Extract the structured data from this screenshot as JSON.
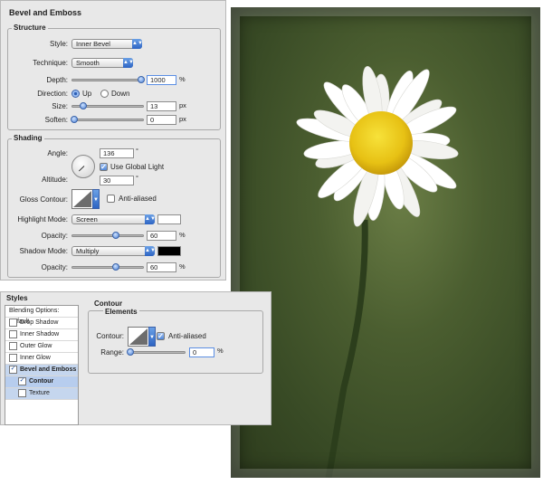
{
  "bevel_panel": {
    "title": "Bevel and Emboss",
    "structure": {
      "title": "Structure",
      "style": {
        "label": "Style:",
        "value": "Inner Bevel"
      },
      "technique": {
        "label": "Technique:",
        "value": "Smooth"
      },
      "depth": {
        "label": "Depth:",
        "value": "1000",
        "unit": "%",
        "slider_fraction": 1.0
      },
      "direction": {
        "label": "Direction:",
        "up": "Up",
        "down": "Down",
        "selected": "Up"
      },
      "size": {
        "label": "Size:",
        "value": "13",
        "unit": "px",
        "slider_fraction": 0.1
      },
      "soften": {
        "label": "Soften:",
        "value": "0",
        "unit": "px",
        "slider_fraction": 0.0
      }
    },
    "shading": {
      "title": "Shading",
      "angle": {
        "label": "Angle:",
        "value": "136",
        "unit": "°"
      },
      "global_light": {
        "label": "Use Global Light",
        "checked": true
      },
      "altitude": {
        "label": "Altitude:",
        "value": "30",
        "unit": "°"
      },
      "gloss_contour": {
        "label": "Gloss Contour:",
        "anti_aliased_label": "Anti-aliased",
        "anti_aliased": false
      },
      "highlight_mode": {
        "label": "Highlight Mode:",
        "value": "Screen",
        "color": "#ffffff"
      },
      "highlight_opacity": {
        "label": "Opacity:",
        "value": "60",
        "unit": "%",
        "slider_fraction": 0.6
      },
      "shadow_mode": {
        "label": "Shadow Mode:",
        "value": "Multiply",
        "color": "#000000"
      },
      "shadow_opacity": {
        "label": "Opacity:",
        "value": "60",
        "unit": "%",
        "slider_fraction": 0.6
      }
    }
  },
  "styles_panel": {
    "list_title": "Styles",
    "items": [
      {
        "label": "Blending Options: Default",
        "checkbox": false,
        "checked": false
      },
      {
        "label": "Drop Shadow",
        "checkbox": true,
        "checked": false
      },
      {
        "label": "Inner Shadow",
        "checkbox": true,
        "checked": false
      },
      {
        "label": "Outer Glow",
        "checkbox": true,
        "checked": false
      },
      {
        "label": "Inner Glow",
        "checkbox": true,
        "checked": false
      },
      {
        "label": "Bevel and Emboss",
        "checkbox": true,
        "checked": true
      },
      {
        "label": "Contour",
        "checkbox": true,
        "checked": true
      },
      {
        "label": "Texture",
        "checkbox": true,
        "checked": false
      }
    ],
    "contour": {
      "title": "Contour",
      "elements_title": "Elements",
      "contour_label": "Contour:",
      "anti_aliased_label": "Anti-aliased",
      "anti_aliased": true,
      "range_label": "Range:",
      "range_value": "0",
      "range_unit": "%",
      "range_fraction": 0.0
    }
  },
  "colors": {
    "accent": "#3b6fd0",
    "petal": "#ffffff",
    "center": "#f2d21c"
  }
}
